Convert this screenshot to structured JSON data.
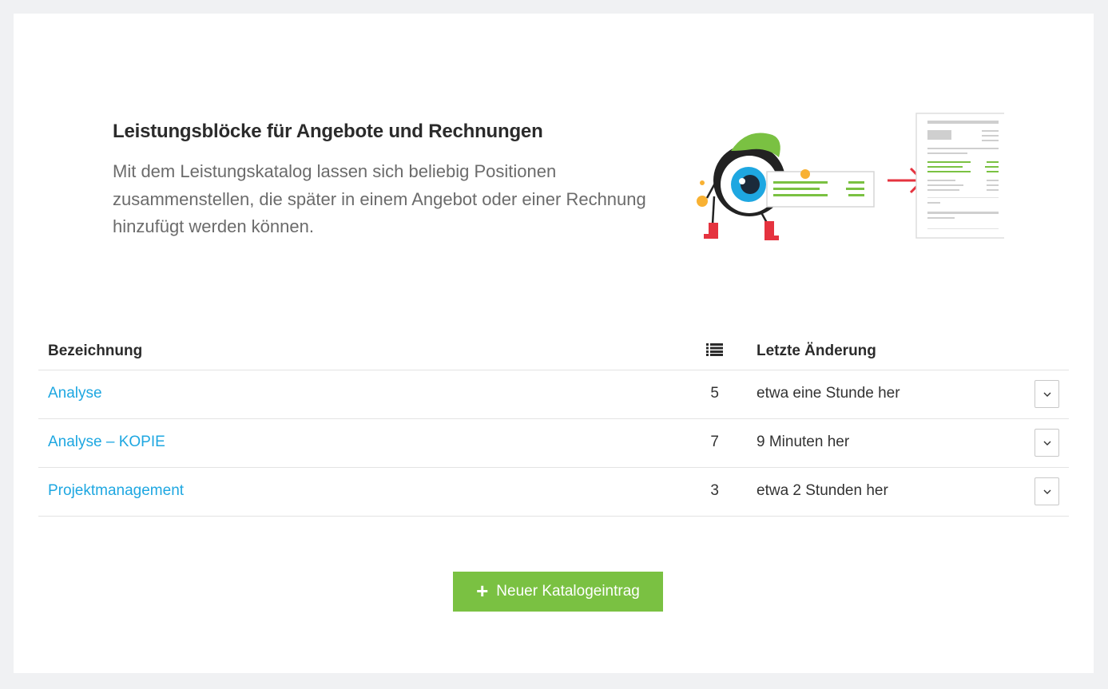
{
  "hero": {
    "title": "Leistungsblöcke für Angebote und Rechnungen",
    "description": "Mit dem Leistungskatalog lassen sich beliebig Positionen zusammenstellen, die später in einem Angebot oder einer Rechnung hinzufügt werden können."
  },
  "table": {
    "columns": {
      "name": "Bezeichnung",
      "count_icon": "list-icon",
      "changed": "Letzte Änderung"
    },
    "rows": [
      {
        "name": "Analyse",
        "count": "5",
        "changed": "etwa eine Stunde her"
      },
      {
        "name": "Analyse – KOPIE",
        "count": "7",
        "changed": "9 Minuten her"
      },
      {
        "name": "Projektmanagement",
        "count": "3",
        "changed": "etwa 2 Stunden her"
      }
    ]
  },
  "actions": {
    "new_entry_label": "Neuer Katalogeintrag",
    "new_entry_icon": "plus-icon"
  },
  "colors": {
    "accent_green": "#7ac142",
    "link_blue": "#1ea7e1",
    "arrow_red": "#e5333f"
  }
}
